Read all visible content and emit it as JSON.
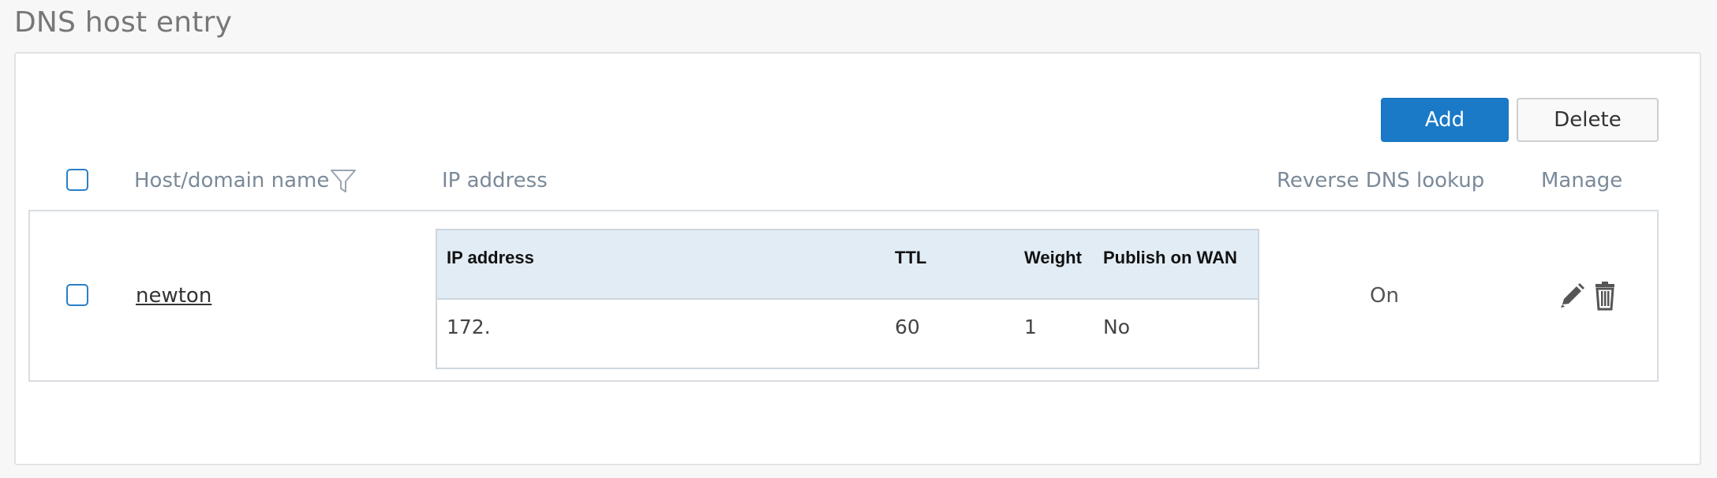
{
  "page": {
    "title": "DNS host entry"
  },
  "toolbar": {
    "add_label": "Add",
    "delete_label": "Delete"
  },
  "table": {
    "columns": {
      "host": "Host/domain name",
      "ip": "IP address",
      "reverse_dns": "Reverse DNS lookup",
      "manage": "Manage"
    },
    "rows": [
      {
        "host": "newton",
        "reverse_dns": "On",
        "ip_table": {
          "headers": {
            "ip": "IP address",
            "ttl": "TTL",
            "weight": "Weight",
            "publish": "Publish on WAN"
          },
          "rows": [
            {
              "ip": "172.",
              "ttl": "60",
              "weight": "1",
              "publish": "No"
            }
          ]
        }
      }
    ]
  },
  "icons": {
    "filter": "filter-icon",
    "edit": "pencil-icon",
    "delete": "trash-icon"
  },
  "colors": {
    "accent": "#1a7ac8",
    "inner_header_bg": "#e1ecf4",
    "header_text": "#7a8a99"
  }
}
